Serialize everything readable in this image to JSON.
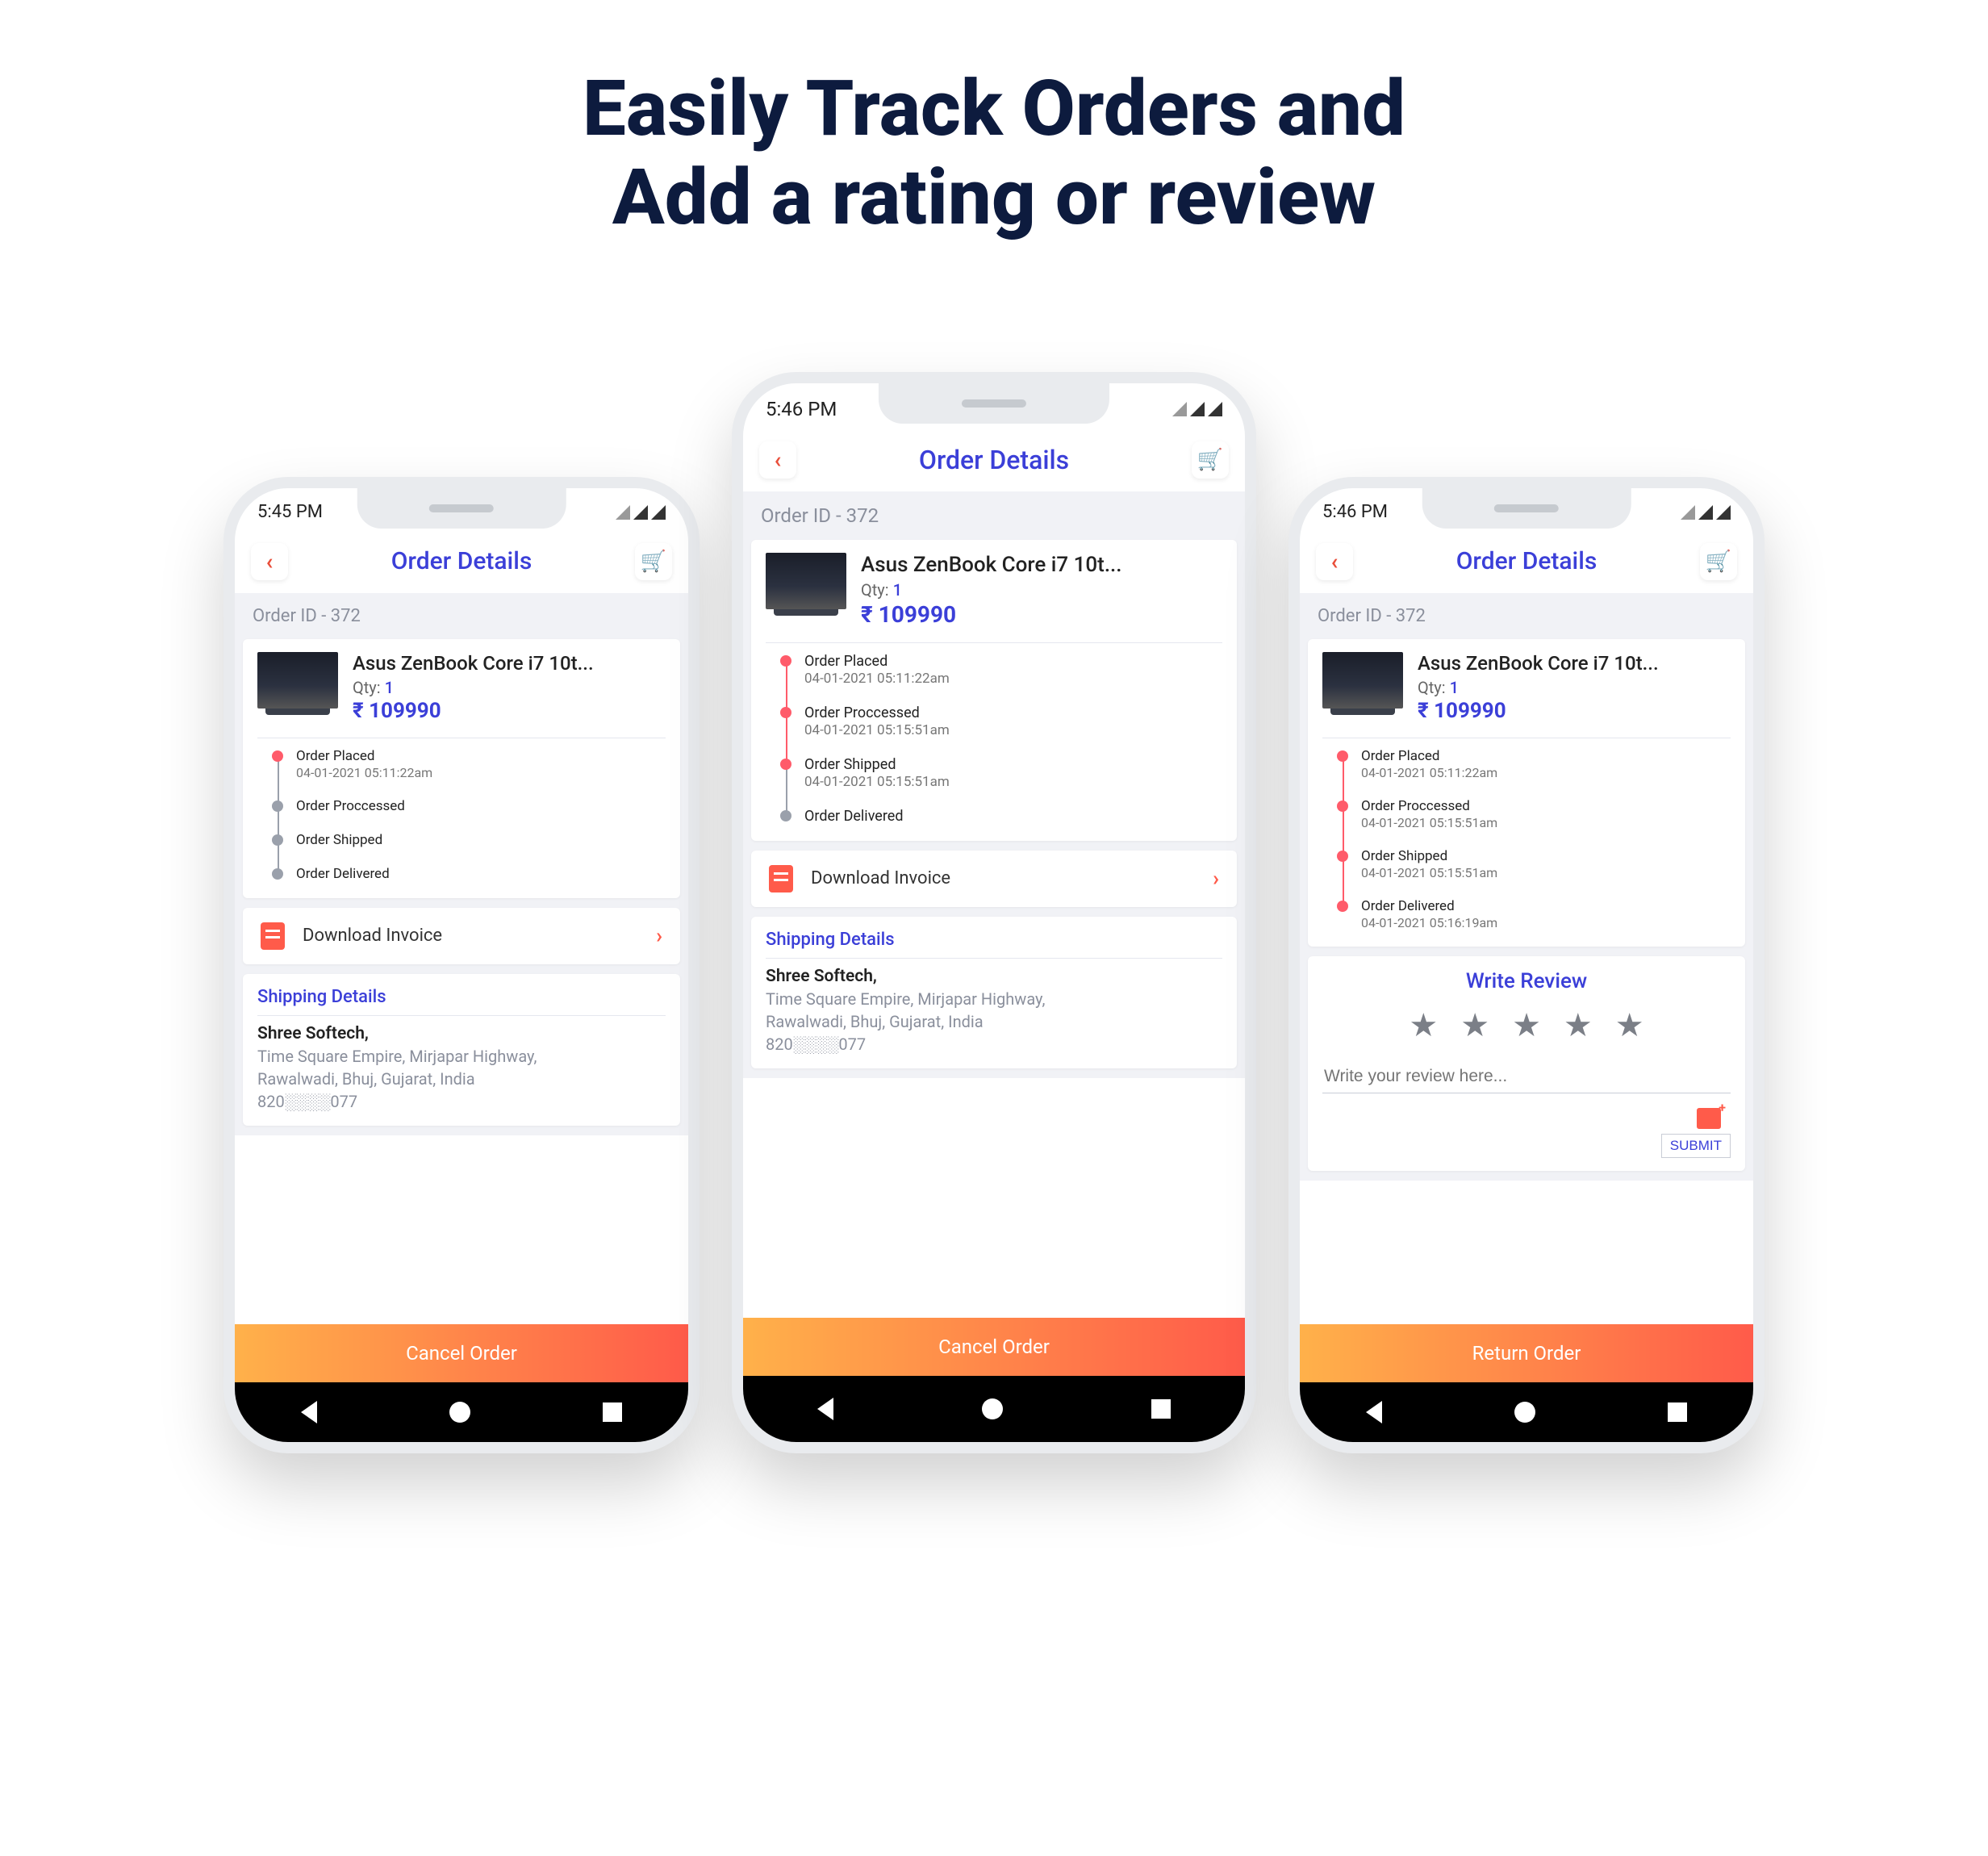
{
  "headline_line1": "Easily Track Orders and",
  "headline_line2": "Add a rating or review",
  "common": {
    "app_title": "Order Details",
    "order_id_label": "Order ID - 372",
    "product": {
      "name": "Asus ZenBook Core i7 10t...",
      "qty_label": "Qty:",
      "qty_value": "1",
      "price": "₹ 109990"
    },
    "invoice_label": "Download Invoice",
    "shipping": {
      "title": "Shipping Details",
      "name": "Shree Softech,",
      "line1": "Time Square Empire, Mirjapar Highway,",
      "line2": "Rawalwadi, Bhuj, Gujarat, India",
      "phone": "820░░░░077"
    },
    "cancel_label": "Cancel Order",
    "return_label": "Return Order"
  },
  "phone1": {
    "time": "5:45 PM",
    "timeline": [
      {
        "title": "Order Placed",
        "sub": "04-01-2021 05:11:22am",
        "active": true
      },
      {
        "title": "Order Proccessed",
        "sub": "",
        "active": false
      },
      {
        "title": "Order Shipped",
        "sub": "",
        "active": false
      },
      {
        "title": "Order Delivered",
        "sub": "",
        "active": false
      }
    ]
  },
  "phone2": {
    "time": "5:46 PM",
    "timeline": [
      {
        "title": "Order Placed",
        "sub": "04-01-2021 05:11:22am",
        "active": true
      },
      {
        "title": "Order Proccessed",
        "sub": "04-01-2021 05:15:51am",
        "active": true
      },
      {
        "title": "Order Shipped",
        "sub": "04-01-2021 05:15:51am",
        "active": true
      },
      {
        "title": "Order Delivered",
        "sub": "",
        "active": false
      }
    ]
  },
  "phone3": {
    "time": "5:46 PM",
    "timeline": [
      {
        "title": "Order Placed",
        "sub": "04-01-2021 05:11:22am",
        "active": true
      },
      {
        "title": "Order Proccessed",
        "sub": "04-01-2021 05:15:51am",
        "active": true
      },
      {
        "title": "Order Shipped",
        "sub": "04-01-2021 05:15:51am",
        "active": true
      },
      {
        "title": "Order Delivered",
        "sub": "04-01-2021 05:16:19am",
        "active": true
      }
    ],
    "review": {
      "title": "Write Review",
      "placeholder": "Write your review here...",
      "submit": "SUBMIT"
    }
  }
}
